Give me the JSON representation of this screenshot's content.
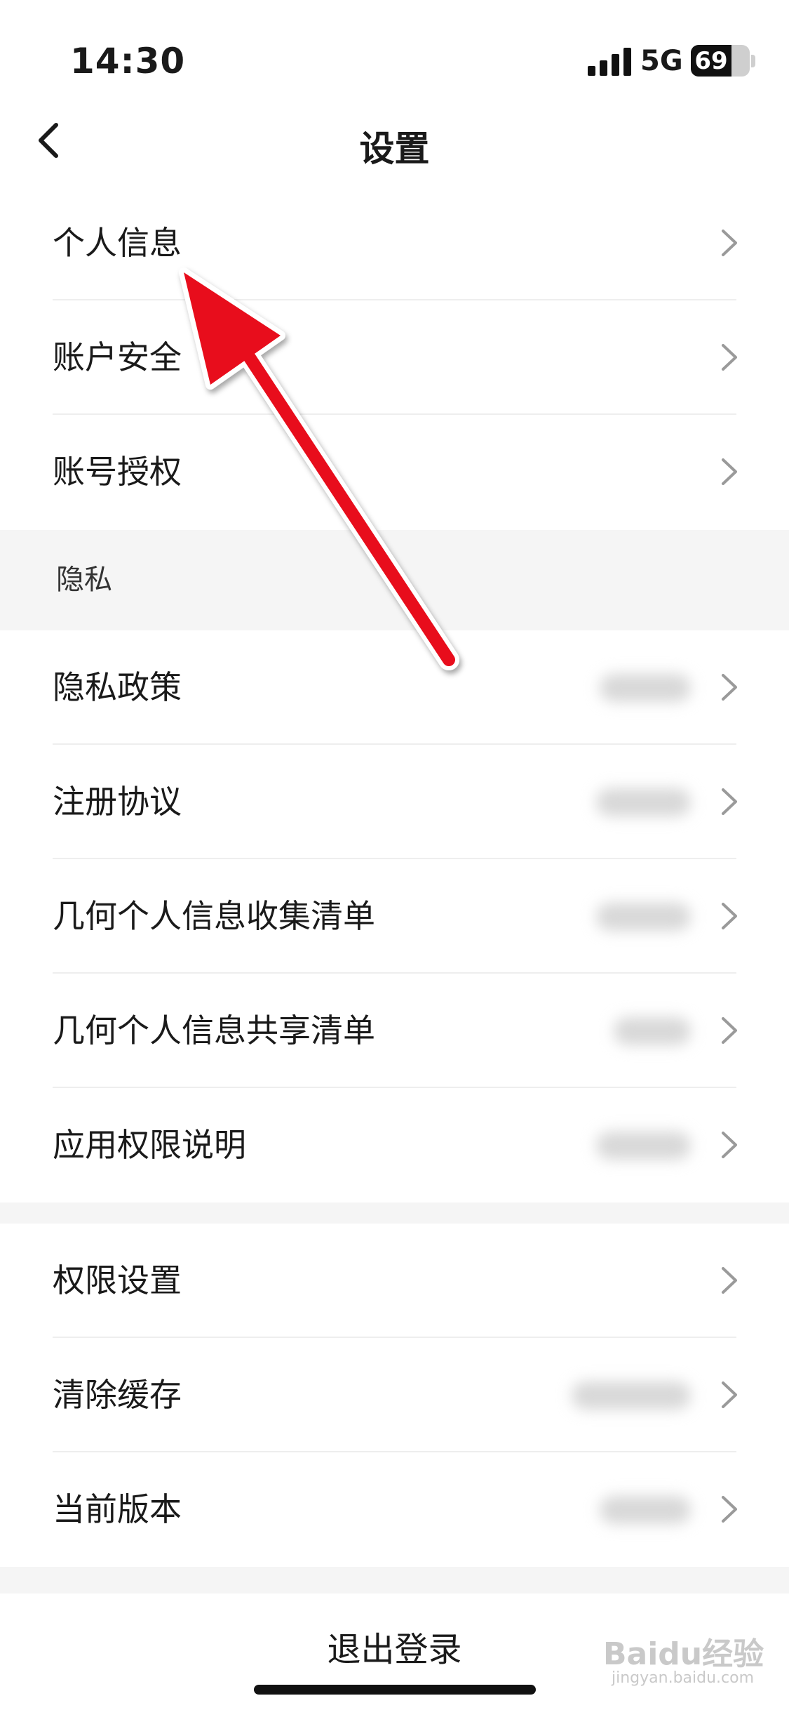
{
  "status_bar": {
    "time": "14:30",
    "network": "5G",
    "battery": "69",
    "battery_level": 0.69
  },
  "nav": {
    "title": "设置",
    "back_icon": "chevron-left-icon"
  },
  "group_account": {
    "items": [
      {
        "label": "个人信息"
      },
      {
        "label": "账户安全"
      },
      {
        "label": "账号授权"
      }
    ]
  },
  "privacy_header": "隐私",
  "group_privacy": {
    "items": [
      {
        "label": "隐私政策"
      },
      {
        "label": "注册协议"
      },
      {
        "label": "几何个人信息收集清单"
      },
      {
        "label": "几何个人信息共享清单"
      },
      {
        "label": "应用权限说明"
      }
    ]
  },
  "group_other": {
    "items": [
      {
        "label": "权限设置"
      },
      {
        "label": "清除缓存"
      },
      {
        "label": "当前版本"
      }
    ]
  },
  "logout_label": "退出登录",
  "watermark": {
    "brand": "Baidu经验",
    "domain": "jingyan.baidu.com"
  },
  "colors": {
    "annotation_arrow": "#e8101d",
    "section_gap": "#f5f5f5"
  }
}
